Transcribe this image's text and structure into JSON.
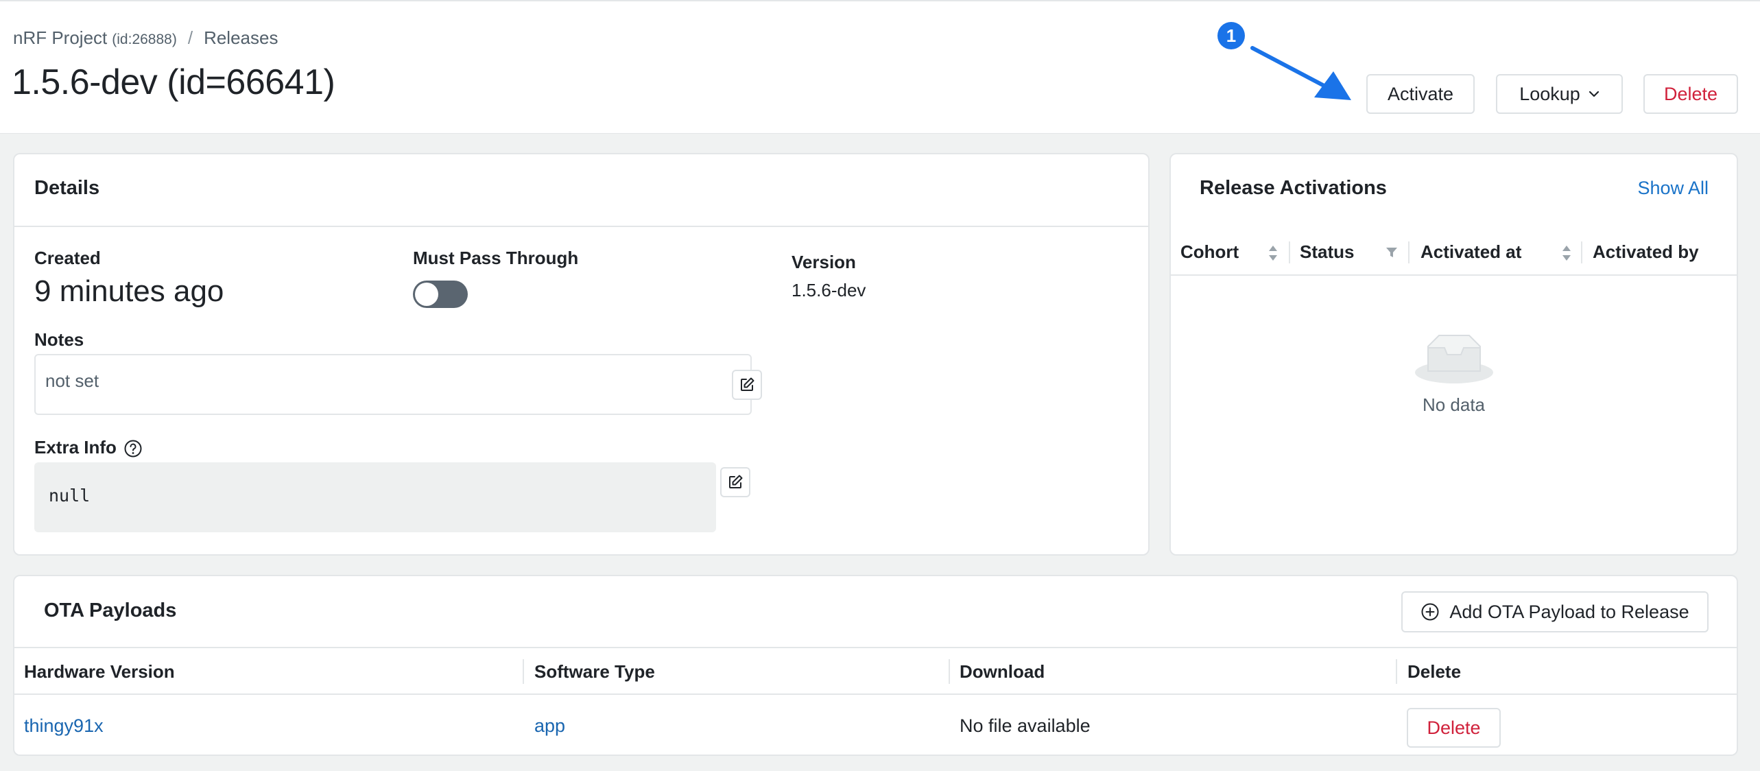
{
  "breadcrumb": {
    "project": "nRF Project",
    "project_id": "(id:26888)",
    "separator": "/",
    "section": "Releases"
  },
  "page": {
    "title": "1.5.6-dev (id=66641)"
  },
  "actions": {
    "activate": "Activate",
    "lookup": "Lookup",
    "delete": "Delete"
  },
  "annotation": {
    "badge": "1",
    "color": "#1a73e8"
  },
  "details": {
    "title": "Details",
    "created_label": "Created",
    "created_value": "9 minutes ago",
    "must_pass_label": "Must Pass Through",
    "must_pass_on": false,
    "version_label": "Version",
    "version_value": "1.5.6-dev",
    "notes_label": "Notes",
    "notes_value": "not set",
    "extra_label": "Extra Info",
    "extra_value": "null"
  },
  "activations": {
    "title": "Release Activations",
    "show_all": "Show All",
    "columns": [
      "Cohort",
      "Status",
      "Activated at",
      "Activated by"
    ],
    "empty_text": "No data"
  },
  "ota": {
    "title": "OTA Payloads",
    "add_button": "Add OTA Payload to Release",
    "columns": [
      "Hardware Version",
      "Software Type",
      "Download",
      "Delete"
    ],
    "rows": [
      {
        "hardware": "thingy91x",
        "software": "app",
        "download": "No file available",
        "delete": "Delete"
      }
    ]
  },
  "colors": {
    "accent": "#1a73c8",
    "danger": "#d0213b"
  }
}
